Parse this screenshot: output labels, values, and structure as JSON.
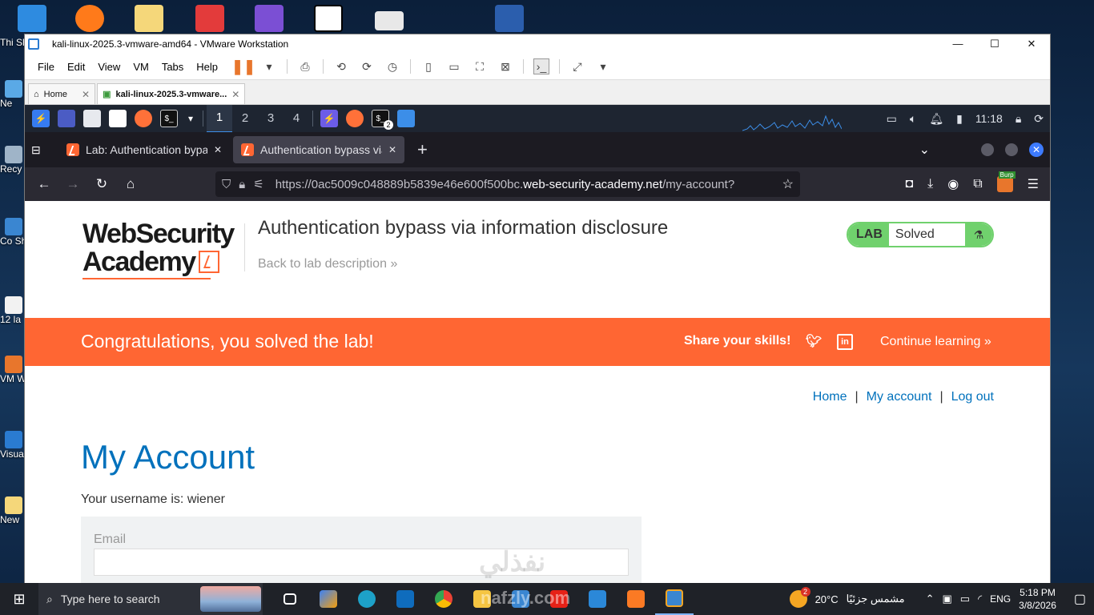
{
  "vmware": {
    "title": "kali-linux-2025.3-vmware-amd64 - VMware Workstation",
    "menu": [
      "File",
      "Edit",
      "View",
      "VM",
      "Tabs",
      "Help"
    ],
    "tabs": [
      {
        "label": "Home"
      },
      {
        "label": "kali-linux-2025.3-vmware..."
      }
    ]
  },
  "kali_panel": {
    "workspaces": [
      "1",
      "2",
      "3",
      "4"
    ],
    "active_workspace": "1",
    "terminal_badge": "2",
    "clock": "11:18"
  },
  "firefox": {
    "tabs": [
      {
        "title": "Lab: Authentication bypas"
      },
      {
        "title": "Authentication bypass via"
      }
    ],
    "url_prefix": "https://0ac5009c048889b5839e46e600f500bc.",
    "url_domain": "web-security-academy.net",
    "url_path": "/my-account?",
    "burp_badge": "Burp"
  },
  "page": {
    "logo_line1": "WebSecurity",
    "logo_line2": "Academy",
    "lab_title": "Authentication bypass via information disclosure",
    "back_link": "Back to lab description",
    "lab_badge": "LAB",
    "lab_status": "Solved",
    "banner_message": "Congratulations, you solved the lab!",
    "share_label": "Share your skills!",
    "continue_label": "Continue learning",
    "nav": {
      "home": "Home",
      "sep": "|",
      "account": "My account",
      "logout": "Log out"
    },
    "heading": "My Account",
    "username_text": "Your username is: wiener",
    "email_label": "Email",
    "email_value": ""
  },
  "desktop": {
    "left_labels": [
      "Thi Sh",
      "Ne",
      "Recy",
      "Co Sh",
      "12 la",
      "VM Wor",
      "Visua C",
      "New"
    ]
  },
  "taskbar": {
    "search_placeholder": "Type here to search",
    "weather_temp": "20°C",
    "weather_desc": "مشمس جزئيًا",
    "weather_badge": "2",
    "language": "ENG",
    "time": "5:18 PM",
    "date": "3/8/2026"
  },
  "watermark": {
    "arabic": "نفذلي",
    "latin": "nafzly.com"
  },
  "colors": {
    "accent_orange": "#ff6633",
    "solved_green": "#70d16d",
    "link_blue": "#0071bc",
    "kali_panel": "#1e2531",
    "firefox_dark": "#1c1b22"
  }
}
